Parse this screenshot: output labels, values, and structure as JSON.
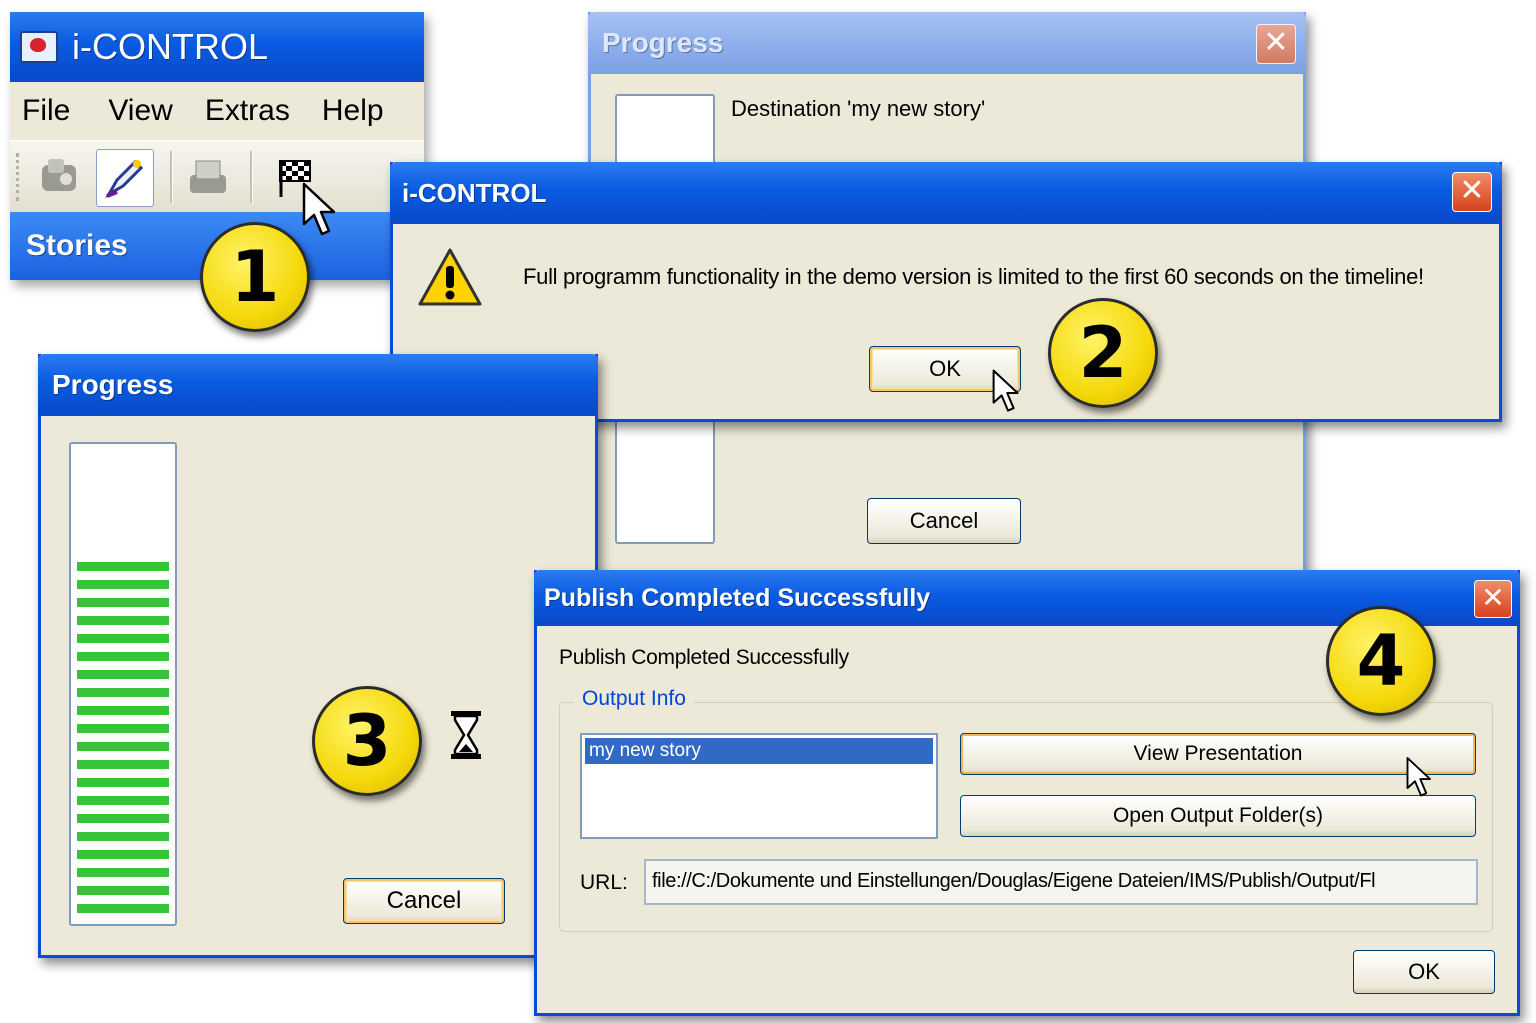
{
  "main_window": {
    "title": "i-CONTROL",
    "menu": [
      "File",
      "View",
      "Extras",
      "Help"
    ],
    "panel_title": "Stories"
  },
  "progress_back": {
    "title": "Progress",
    "destination": "Destination 'my new story'",
    "cancel": "Cancel"
  },
  "alert": {
    "title": "i-CONTROL",
    "message": "Full programm functionality in the demo version is limited to the first 60 seconds on the timeline!",
    "ok": "OK"
  },
  "progress_front": {
    "title": "Progress",
    "cancel": "Cancel",
    "bar_segments": 20
  },
  "publish": {
    "title": "Publish Completed Successfully",
    "message": "Publish Completed Successfully",
    "group_label": "Output Info",
    "list_items": [
      "my new story"
    ],
    "view_button": "View Presentation",
    "open_button": "Open Output Folder(s)",
    "url_label": "URL:",
    "url_value": "file://C:/Dokumente und Einstellungen/Douglas/Eigene Dateien/IMS/Publish/Output/Fl",
    "ok": "OK"
  },
  "steps": [
    "1",
    "2",
    "3",
    "4"
  ],
  "icons": {
    "app": "app-icon",
    "warning": "warning-icon",
    "hourglass": "hourglass-icon",
    "publish": "checkered-flag-icon"
  },
  "colors": {
    "xp_blue": "#0a5be2",
    "dialog_bg": "#ece9d8",
    "progress_green": "#35c43a",
    "badge_yellow": "#f5d90a",
    "close_red": "#d8411c",
    "selection": "#316ac5"
  }
}
